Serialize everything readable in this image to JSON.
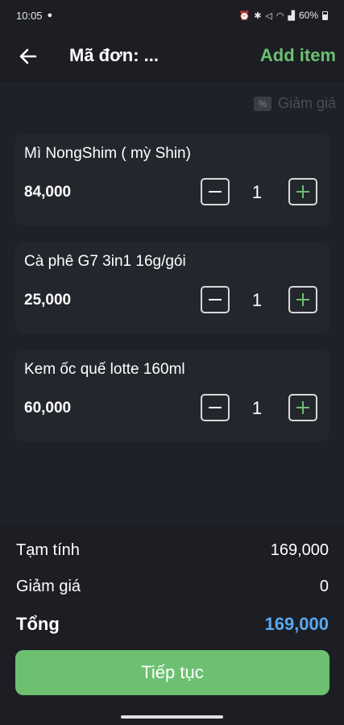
{
  "status_bar": {
    "time": "10:05",
    "battery": "60%"
  },
  "header": {
    "title": "Mã đơn: ...",
    "add_item": "Add item"
  },
  "discount_button": {
    "label": "Giảm giá"
  },
  "items": [
    {
      "name": "Mì NongShim ( mỳ Shin)",
      "price": "84,000",
      "quantity": "1"
    },
    {
      "name": "Cà phê G7 3in1 16g/gói",
      "price": "25,000",
      "quantity": "1"
    },
    {
      "name": "Kem ốc quế lotte 160ml",
      "price": "60,000",
      "quantity": "1"
    }
  ],
  "summary": {
    "subtotal_label": "Tạm tính",
    "subtotal_value": "169,000",
    "discount_label": "Giảm giá",
    "discount_value": "0",
    "total_label": "Tổng",
    "total_value": "169,000"
  },
  "continue_button": {
    "label": "Tiếp tục"
  },
  "colors": {
    "accent_green": "#6cc070",
    "total_blue": "#5aa8f0",
    "background": "#1c1e24",
    "card": "#24262d"
  }
}
